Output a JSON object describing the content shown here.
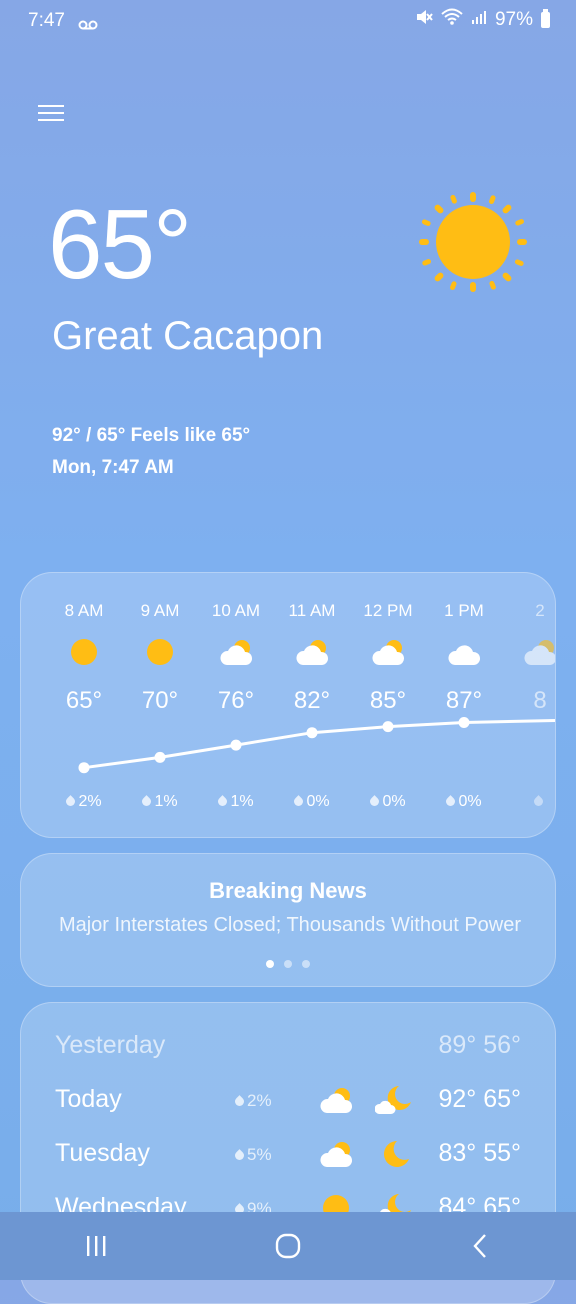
{
  "status_bar": {
    "time": "7:47",
    "voicemail": "ꝏ",
    "battery": "97%"
  },
  "current": {
    "temp": "65°",
    "location": "Great Cacapon",
    "hilo_feels": "92° / 65° Feels like 65°",
    "datetime": "Mon, 7:47 AM",
    "icon": "sun-icon"
  },
  "hourly": [
    {
      "time": "8 AM",
      "icon": "sun-icon",
      "temp": "65°",
      "precip": "2%"
    },
    {
      "time": "9 AM",
      "icon": "sun-icon",
      "temp": "70°",
      "precip": "1%"
    },
    {
      "time": "10 AM",
      "icon": "partly-cloudy-icon",
      "temp": "76°",
      "precip": "1%"
    },
    {
      "time": "11 AM",
      "icon": "partly-cloudy-icon",
      "temp": "82°",
      "precip": "0%"
    },
    {
      "time": "12 PM",
      "icon": "partly-cloudy-icon",
      "temp": "85°",
      "precip": "0%"
    },
    {
      "time": "1 PM",
      "icon": "cloudy-icon",
      "temp": "87°",
      "precip": "0%"
    },
    {
      "time": "2",
      "icon": "partly-cloudy-icon",
      "temp": "8",
      "precip": ""
    }
  ],
  "news": {
    "headline": "Breaking News",
    "desc": "Major Interstates Closed; Thousands Without Power",
    "pages": 3,
    "active_page": 1
  },
  "daily": [
    {
      "name": "Yesterday",
      "temps": "89° 56°",
      "precip": "",
      "dim": true
    },
    {
      "name": "Today",
      "temps": "92° 65°",
      "precip": "2%",
      "icon_day": "partly-cloudy-icon",
      "icon_night": "partly-cloudy-night-icon"
    },
    {
      "name": "Tuesday",
      "temps": "83° 55°",
      "precip": "5%",
      "icon_day": "partly-cloudy-icon",
      "icon_night": "moon-icon"
    },
    {
      "name": "Wednesday",
      "temps": "84° 65°",
      "precip": "9%",
      "icon_day": "sun-icon",
      "icon_night": "partly-cloudy-night-icon"
    }
  ],
  "colors": {
    "sun": "#ffbd14",
    "cloud": "#ffffff",
    "navbar": "#6d96d2"
  }
}
